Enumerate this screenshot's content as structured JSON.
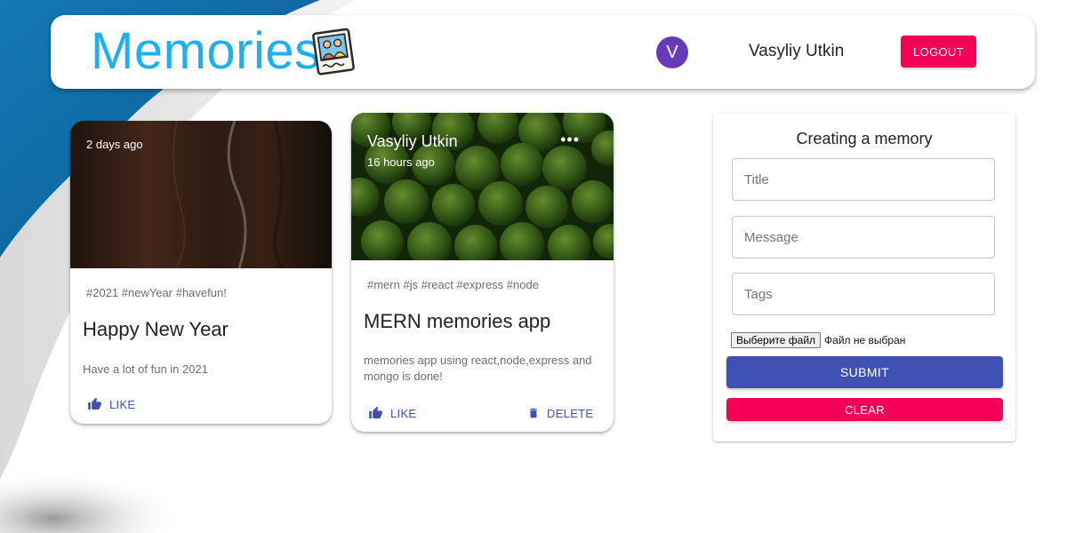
{
  "header": {
    "brand": "Memories",
    "brand_icon": "memories-photo-icon",
    "avatar_letter": "V",
    "user_name": "Vasyliy Utkin",
    "logout_label": "LOGOUT"
  },
  "posts": [
    {
      "time": "2 days ago",
      "tags": "#2021 #newYear #havefun!",
      "title": "Happy New Year",
      "message": "Have a lot of fun in 2021",
      "like_label": "LIKE"
    },
    {
      "author": "Vasyliy Utkin",
      "time": "16 hours ago",
      "more": "•••",
      "tags": "#mern #js #react #express #node",
      "title": "MERN memories app",
      "message": "memories app using react,node,express and mongo is done!",
      "like_label": "LIKE",
      "delete_label": "DELETE"
    }
  ],
  "form": {
    "title": "Creating a memory",
    "title_placeholder": "Title",
    "message_placeholder": "Message",
    "tags_placeholder": "Tags",
    "file_button": "Выберите файл",
    "file_status": "Файл не выбран",
    "submit_label": "SUBMIT",
    "clear_label": "CLEAR"
  },
  "colors": {
    "brand": "#1ab0f2",
    "avatar": "#673ab7",
    "primary": "#3f51b5",
    "secondary": "#f50057"
  }
}
